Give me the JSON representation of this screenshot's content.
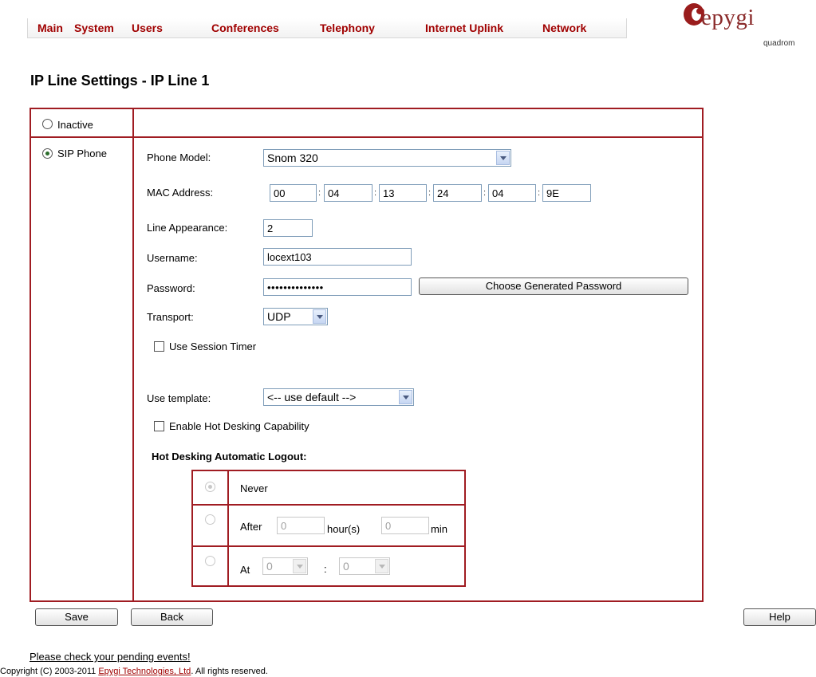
{
  "nav": {
    "items": [
      "Main",
      "System",
      "Users",
      "Conferences",
      "Telephony",
      "Internet Uplink",
      "Network"
    ]
  },
  "logo": {
    "text": "epygi",
    "sub": "quadrom"
  },
  "page": {
    "title": "IP Line Settings - IP Line 1"
  },
  "modes": {
    "inactive": "Inactive",
    "sip_phone": "SIP Phone",
    "selected": "SIP Phone"
  },
  "form": {
    "phone_model": {
      "label": "Phone Model:",
      "value": "Snom 320"
    },
    "mac": {
      "label": "MAC Address:",
      "parts": [
        "00",
        "04",
        "13",
        "24",
        "04",
        "9E"
      ]
    },
    "line_appearance": {
      "label": "Line Appearance:",
      "value": "2"
    },
    "username": {
      "label": "Username:",
      "value": "locext103"
    },
    "password": {
      "label": "Password:",
      "value": "••••••••••••••",
      "generate_button": "Choose Generated Password"
    },
    "transport": {
      "label": "Transport:",
      "value": "UDP"
    },
    "session_timer": {
      "label": "Use Session Timer",
      "checked": false
    },
    "template": {
      "label": "Use template:",
      "value": "<-- use default -->"
    },
    "hot_desking": {
      "label": "Enable Hot Desking Capability",
      "checked": false
    }
  },
  "logout": {
    "title": "Hot Desking Automatic Logout:",
    "never": "Never",
    "after": {
      "label": "After",
      "hours": "0",
      "hours_unit": "hour(s)",
      "minutes": "0",
      "minutes_unit": "min"
    },
    "at": {
      "label": "At",
      "hour": "0",
      "separator": ":",
      "minute": "0"
    },
    "selected": "Never"
  },
  "buttons": {
    "save": "Save",
    "back": "Back",
    "help": "Help"
  },
  "footer": {
    "pending_link": "Please check your pending events!",
    "copyright_prefix": "Copyright (C) 2003-2011",
    "company": "Epygi Technologies, Ltd",
    "copyright_suffix": ". All rights reserved."
  },
  "colors": {
    "brand": "#a00000",
    "border": "#a01c22"
  }
}
